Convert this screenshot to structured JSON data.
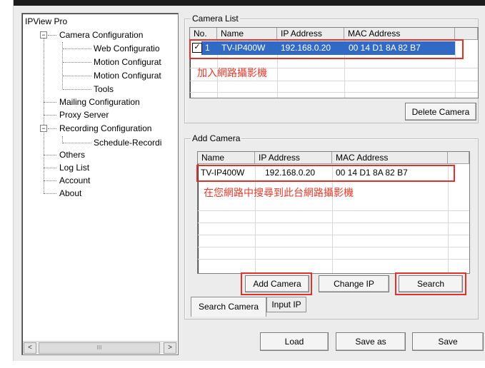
{
  "tree": {
    "root": "IPView Pro",
    "camera_config": "Camera Configuration",
    "web_config": "Web Configuratio",
    "motion_config_1": "Motion Configurat",
    "motion_config_2": "Motion Configurat",
    "tools": "Tools",
    "mailing": "Mailing Configuration",
    "proxy": "Proxy Server",
    "recording": "Recording Configuration",
    "schedule": "Schedule-Recordi",
    "others": "Others",
    "log": "Log List",
    "account": "Account",
    "about": "About",
    "expand_minus": "−"
  },
  "scroll": {
    "left": "<",
    "right": ">",
    "thumb": "III"
  },
  "camera_list": {
    "legend": "Camera List",
    "columns": [
      "No.",
      "Name",
      "IP Address",
      "MAC Address"
    ],
    "row": {
      "checked": "✓",
      "no": "1",
      "name": "TV-IP400W",
      "ip": "192.168.0.20",
      "mac": "00 14 D1 8A 82 B7"
    },
    "annotation": "加入網路攝影機",
    "delete_button": "Delete Camera"
  },
  "add_camera": {
    "legend": "Add Camera",
    "columns": [
      "Name",
      "IP Address",
      "MAC Address"
    ],
    "row": {
      "name": "TV-IP400W",
      "ip": "192.168.0.20",
      "mac": "00 14 D1 8A 82 B7"
    },
    "annotation": "在您網路中搜尋到此台網路攝影機",
    "add_button": "Add Camera",
    "change_ip_button": "Change IP",
    "search_button": "Search"
  },
  "tabs": {
    "search_camera": "Search Camera",
    "input_ip": "Input IP"
  },
  "bottom_buttons": {
    "load": "Load",
    "save_as": "Save as",
    "save": "Save"
  },
  "colors": {
    "selection": "#316ac5",
    "annotation_red": "#e0322c"
  }
}
